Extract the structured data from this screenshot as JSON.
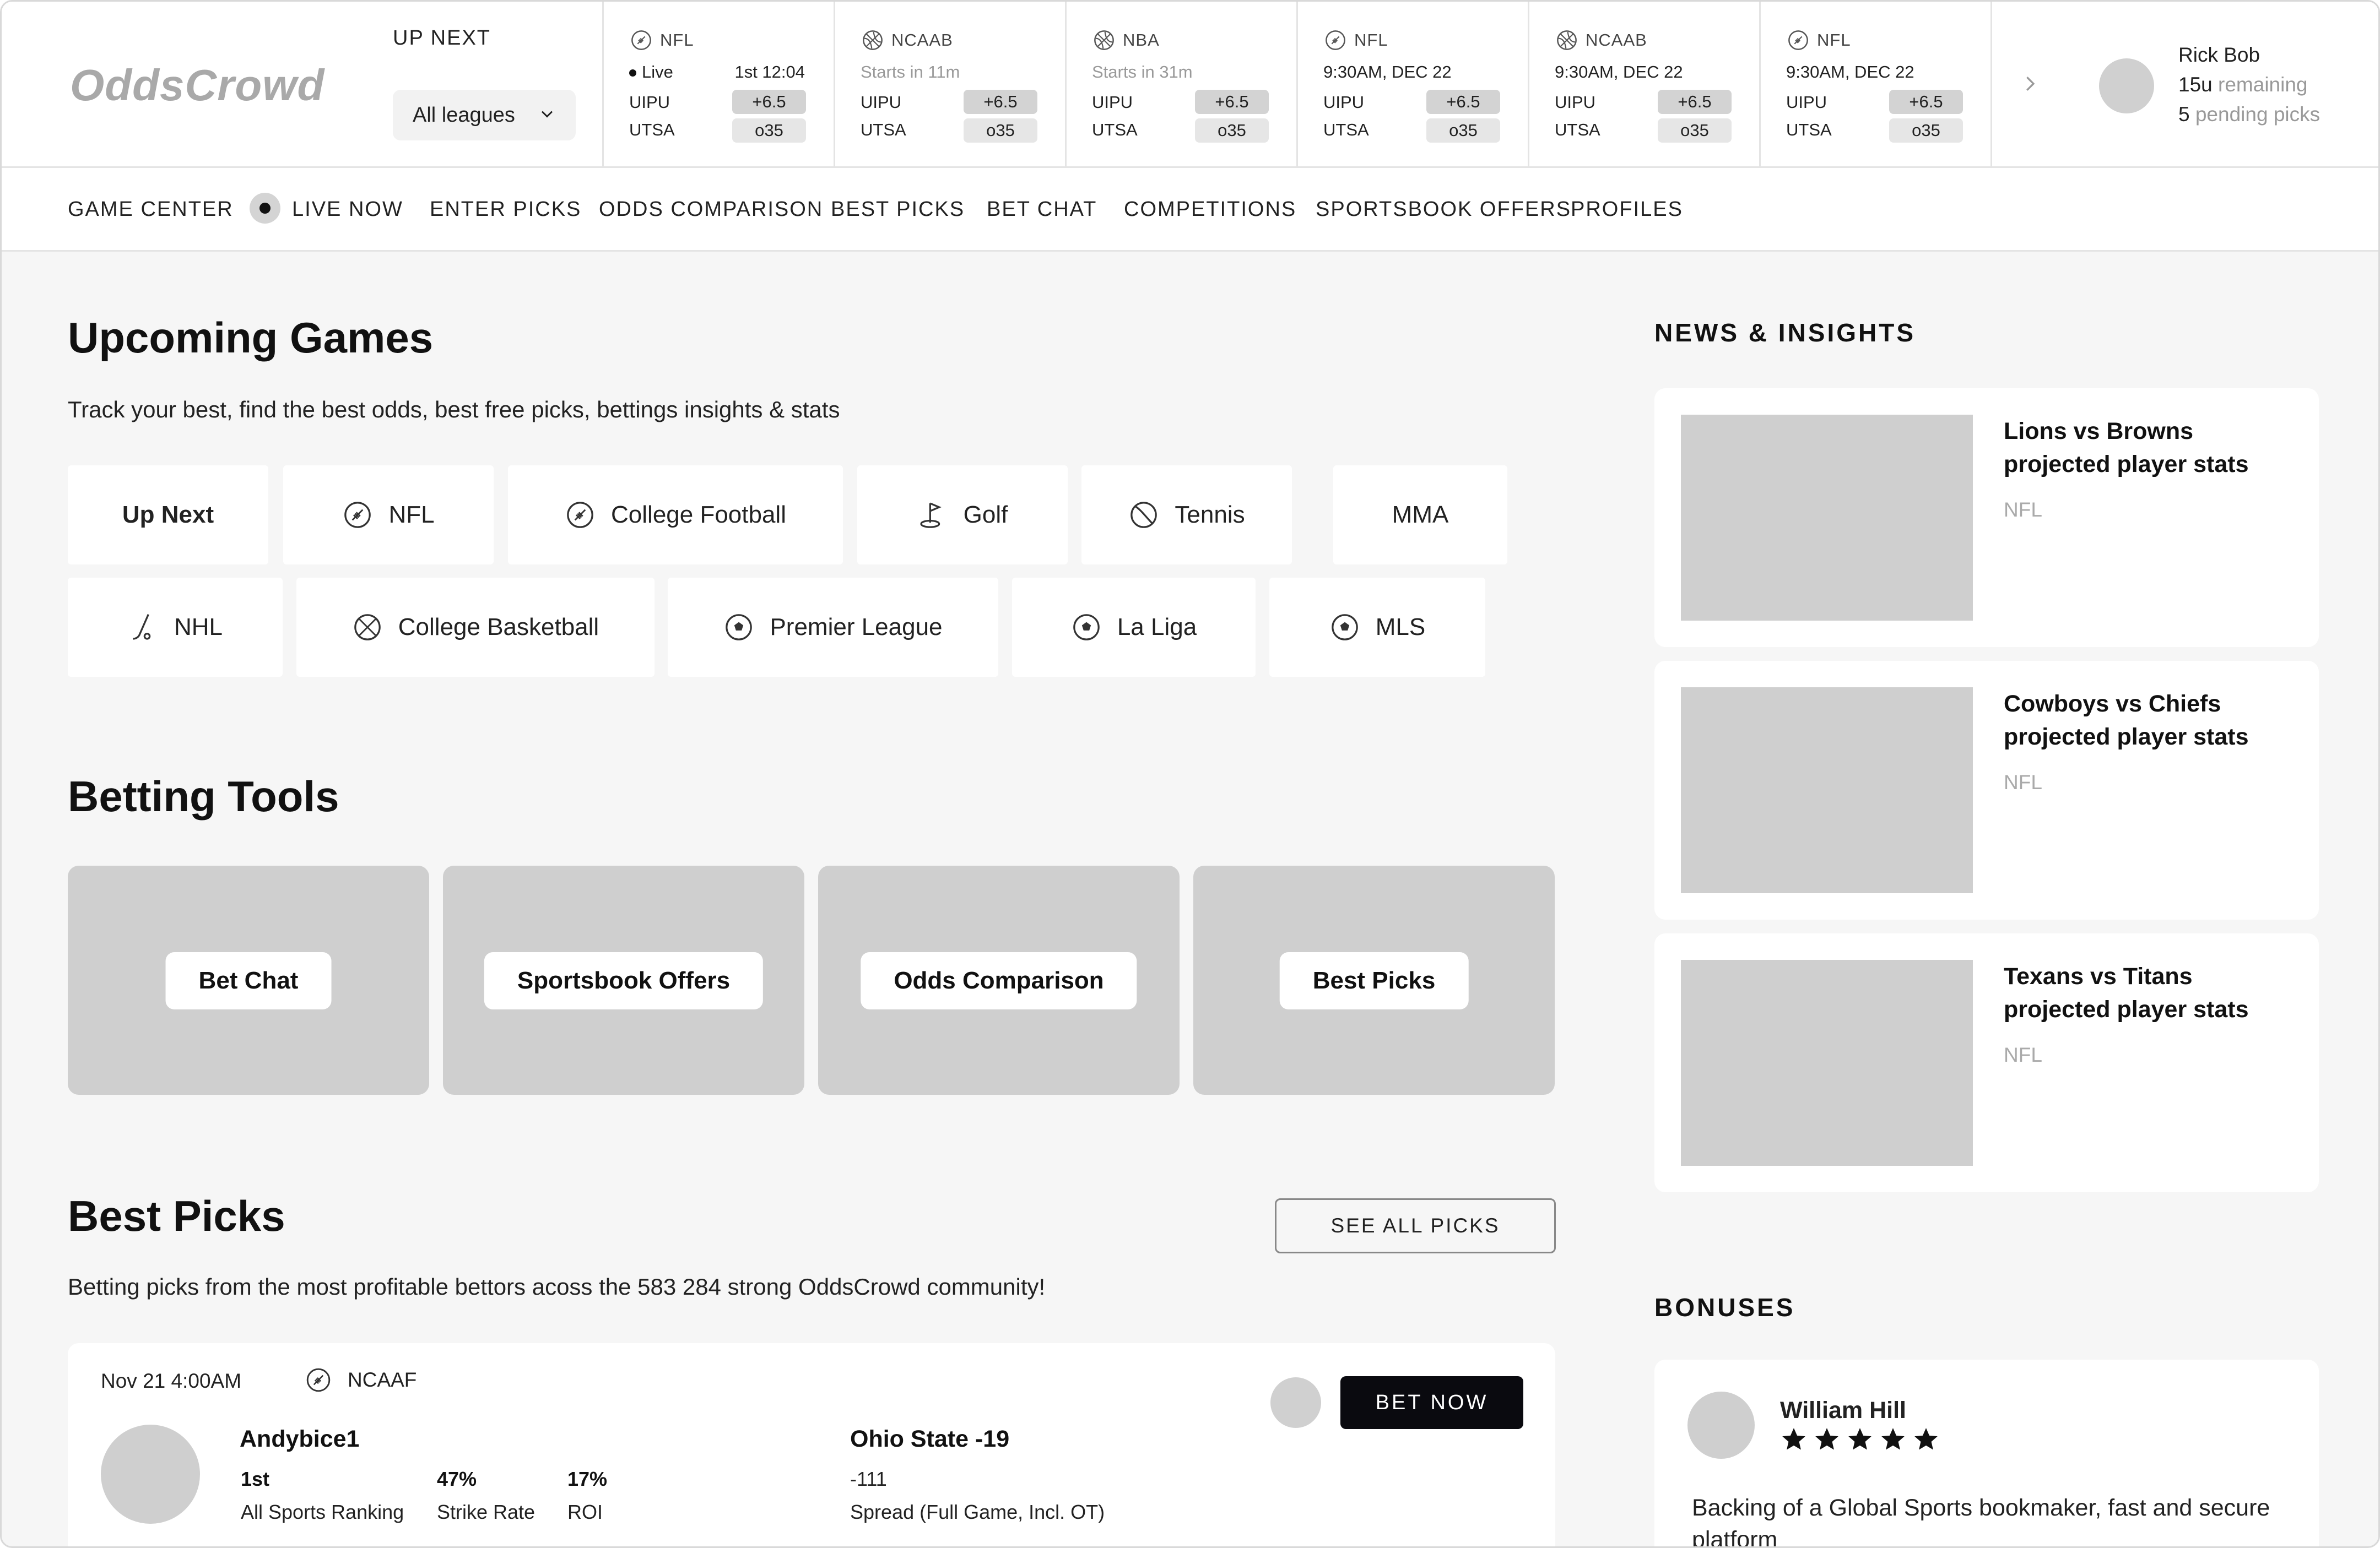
{
  "header": {
    "logo": "OddsCrowd",
    "up_next_label": "UP NEXT",
    "league_select": "All leagues",
    "games": [
      {
        "league": "NFL",
        "icon": "football-icon",
        "status": "Live",
        "status_live": true,
        "time": "1st 12:04",
        "team1": "UIPU",
        "team2": "UTSA",
        "spread": "+6.5",
        "total": "o35"
      },
      {
        "league": "NCAAB",
        "icon": "basketball-icon",
        "status": "Starts in 11m",
        "status_live": false,
        "time": "",
        "team1": "UIPU",
        "team2": "UTSA",
        "spread": "+6.5",
        "total": "o35"
      },
      {
        "league": "NBA",
        "icon": "basketball-icon",
        "status": "Starts in 31m",
        "status_live": false,
        "time": "",
        "team1": "UIPU",
        "team2": "UTSA",
        "spread": "+6.5",
        "total": "o35"
      },
      {
        "league": "NFL",
        "icon": "football-icon",
        "status": "9:30AM, DEC 22",
        "status_live": false,
        "time": "",
        "team1": "UIPU",
        "team2": "UTSA",
        "spread": "+6.5",
        "total": "o35"
      },
      {
        "league": "NCAAB",
        "icon": "basketball-icon",
        "status": "9:30AM, DEC 22",
        "status_live": false,
        "time": "",
        "team1": "UIPU",
        "team2": "UTSA",
        "spread": "+6.5",
        "total": "o35"
      },
      {
        "league": "NFL",
        "icon": "football-icon",
        "status": "9:30AM, DEC 22",
        "status_live": false,
        "time": "",
        "team1": "UIPU",
        "team2": "UTSA",
        "spread": "+6.5",
        "total": "o35"
      }
    ],
    "user": {
      "name": "Rick Bob",
      "units_value": "15u",
      "units_label": "remaining",
      "pending_value": "5",
      "pending_label": "pending picks"
    }
  },
  "nav": {
    "items": [
      "GAME CENTER",
      "LIVE NOW",
      "ENTER PICKS",
      "ODDS COMPARISON",
      "BEST PICKS",
      "BET CHAT",
      "COMPETITIONS",
      "SPORTSBOOK OFFERS",
      "PROFILES"
    ]
  },
  "upcoming": {
    "title": "Upcoming Games",
    "subtitle": "Track your best, find the best odds, best free picks, bettings insights & stats",
    "chips": [
      {
        "label": "Up Next",
        "icon": ""
      },
      {
        "label": "NFL",
        "icon": "football-icon"
      },
      {
        "label": "College Football",
        "icon": "football-icon"
      },
      {
        "label": "Golf",
        "icon": "golf-icon"
      },
      {
        "label": "Tennis",
        "icon": "tennis-icon"
      },
      {
        "label": "MMA",
        "icon": ""
      },
      {
        "label": "NHL",
        "icon": "hockey-icon"
      },
      {
        "label": "College Basketball",
        "icon": "basketball-icon"
      },
      {
        "label": "Premier League",
        "icon": "soccer-icon"
      },
      {
        "label": "La Liga",
        "icon": "soccer-icon"
      },
      {
        "label": "MLS",
        "icon": "soccer-icon"
      }
    ]
  },
  "tools": {
    "title": "Betting Tools",
    "items": [
      "Bet Chat",
      "Sportsbook Offers",
      "Odds Comparison",
      "Best Picks"
    ]
  },
  "best_picks": {
    "title": "Best Picks",
    "see_all": "SEE ALL PICKS",
    "subtitle": "Betting picks from  the most profitable bettors acoss the 583 284 strong OddsCrowd community!",
    "pick": {
      "date": "Nov 21 4:00AM",
      "league": "NCAAF",
      "user": "Andybice1",
      "stats": [
        {
          "value": "1st",
          "label": "All Sports Ranking"
        },
        {
          "value": "47%",
          "label": "Strike Rate"
        },
        {
          "value": "17%",
          "label": "ROI"
        }
      ],
      "selection": "Ohio State -19",
      "odds": "-111",
      "market": "Spread (Full Game, Incl. OT)",
      "bet_label": "BET NOW"
    }
  },
  "news": {
    "title": "NEWS & INSIGHTS",
    "items": [
      {
        "title": "Lions vs Browns projected player stats",
        "tag": "NFL"
      },
      {
        "title": "Cowboys vs Chiefs projected player stats",
        "tag": "NFL"
      },
      {
        "title": "Texans vs Titans projected player stats",
        "tag": "NFL"
      }
    ]
  },
  "bonuses": {
    "title": "BONUSES",
    "item": {
      "name": "William Hill",
      "rating": 5,
      "text": "Backing of a Global Sports bookmaker, fast and secure platform"
    }
  }
}
